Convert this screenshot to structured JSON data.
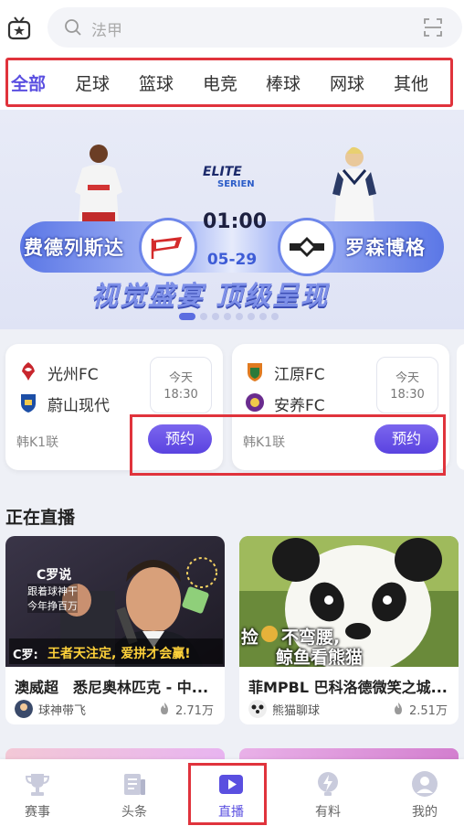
{
  "search": {
    "placeholder": "法甲"
  },
  "tabs": [
    "全部",
    "足球",
    "篮球",
    "电竞",
    "棒球",
    "网球",
    "其他"
  ],
  "banner": {
    "brand": "ELITE",
    "brand_sub": "SERIEN",
    "team_left": "费德列斯达",
    "team_right": "罗森博格",
    "time": "01:00",
    "date": "05-29",
    "slogan": "视觉盛宴 顶级呈现",
    "slide_count": 8,
    "active_slide": 1
  },
  "matches": [
    {
      "home": "光州FC",
      "away": "蔚山现代",
      "day": "今天",
      "time": "18:30",
      "league": "韩K1联",
      "action": "预约"
    },
    {
      "home": "江原FC",
      "away": "安养FC",
      "day": "今天",
      "time": "18:30",
      "league": "韩K1联",
      "action": "预约"
    }
  ],
  "live_section": {
    "title": "正在直播"
  },
  "live": [
    {
      "title": "澳威超　悉尼奥林匹克 - 中...",
      "author": "球神带飞",
      "views": "2.71万",
      "thumb": {
        "label": "C罗说",
        "line1": "跟着球神干",
        "line2": "今年挣百万",
        "caption_prefix": "C罗:",
        "caption": "王者天注定, 爱拼才会赢!"
      }
    },
    {
      "title": "菲MPBL 巴科洛德微笑之城...",
      "author": "熊猫聊球",
      "views": "2.51万",
      "thumb": {
        "line1": "捡",
        "line1b": "不弯腰,",
        "line2": "鲸鱼看熊猫"
      }
    }
  ],
  "nav": [
    {
      "label": "赛事",
      "icon": "trophy-icon"
    },
    {
      "label": "头条",
      "icon": "news-icon"
    },
    {
      "label": "直播",
      "icon": "play-icon",
      "active": true
    },
    {
      "label": "有料",
      "icon": "bolt-icon"
    },
    {
      "label": "我的",
      "icon": "profile-icon"
    }
  ],
  "colors": {
    "accent": "#5a4fe0",
    "annotation": "#e0333c",
    "page_bg": "#eef0f6"
  }
}
